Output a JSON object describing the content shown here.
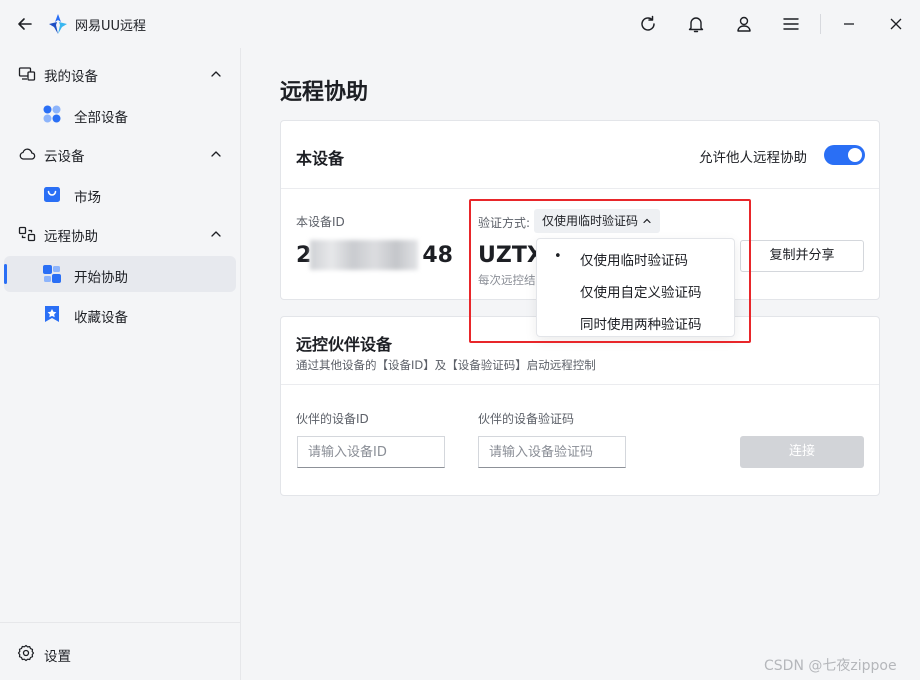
{
  "app": {
    "title": "网易UU远程"
  },
  "colors": {
    "accent": "#2a6ff5",
    "highlight": "#e8262a"
  },
  "titlebar": {
    "icons": [
      "back-arrow-icon",
      "refresh-icon",
      "bell-icon",
      "user-icon",
      "menu-icon",
      "minimize-icon",
      "close-icon"
    ]
  },
  "sidebar": {
    "groups": [
      {
        "label": "我的设备",
        "icon": "devices-icon",
        "expanded": true,
        "items": [
          {
            "label": "全部设备",
            "icon": "grid-icon"
          }
        ]
      },
      {
        "label": "云设备",
        "icon": "cloud-icon",
        "expanded": true,
        "items": [
          {
            "label": "市场",
            "icon": "bag-icon"
          }
        ]
      },
      {
        "label": "远程协助",
        "icon": "remote-icon",
        "expanded": true,
        "items": [
          {
            "label": "开始协助",
            "icon": "start-assist-icon",
            "active": true
          },
          {
            "label": "收藏设备",
            "icon": "star-icon"
          }
        ]
      }
    ],
    "settings_label": "设置"
  },
  "main": {
    "page_title": "远程协助",
    "this_device": {
      "title": "本设备",
      "allow_label": "允许他人远程协助",
      "allow_enabled": true,
      "device_id_label": "本设备ID",
      "device_id_prefix": "2",
      "device_id_suffix": "48",
      "verify_label": "验证方式:",
      "verify_selected": "仅使用临时验证码",
      "code": "UZTX",
      "hint": "每次远控结",
      "copy_share": "复制并分享",
      "dropdown_options": [
        {
          "label": "仅使用临时验证码",
          "selected": true
        },
        {
          "label": "仅使用自定义验证码",
          "selected": false
        },
        {
          "label": "同时使用两种验证码",
          "selected": false
        }
      ]
    },
    "partner": {
      "title": "远控伙伴设备",
      "desc": "通过其他设备的【设备ID】及【设备验证码】启动远程控制",
      "id_label": "伙伴的设备ID",
      "id_placeholder": "请输入设备ID",
      "code_label": "伙伴的设备验证码",
      "code_placeholder": "请输入设备验证码",
      "connect": "连接"
    }
  },
  "watermark": "CSDN @七夜zippoe"
}
